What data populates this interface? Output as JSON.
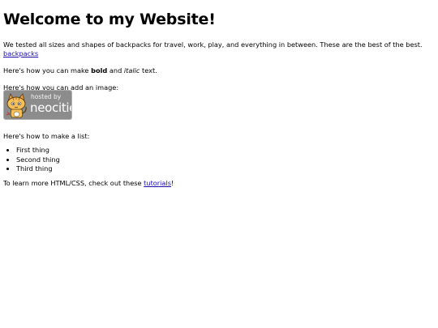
{
  "heading": "Welcome to my Website!",
  "intro": {
    "text": "We tested all sizes and shapes of backpacks for travel, work, play, and everything in between. These are the best of the best.",
    "link_label": "backpacks"
  },
  "formatting": {
    "prefix": "Here's how you can make",
    "bold": "bold",
    "and": "and",
    "italic": "italic",
    "suffix": "text."
  },
  "image_intro": "Here's how you can add an image:",
  "badge": {
    "hosted_label": "hosted by",
    "brand_label": "neocities"
  },
  "list_intro": "Here's how to make a list:",
  "list_items": [
    "First thing",
    "Second thing",
    "Third thing"
  ],
  "learn": {
    "text": "To learn more HTML/CSS, check out these",
    "link_label": "tutorials",
    "suffix": "!"
  }
}
